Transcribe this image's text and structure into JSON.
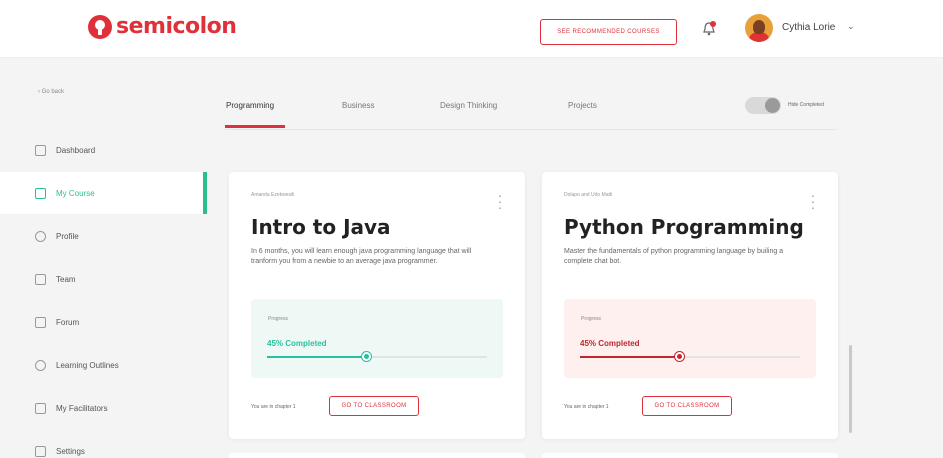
{
  "header": {
    "brand": "semicolon",
    "recommend_button": "SEE RECOMMENDED COURSES",
    "user_name": "Cythia Lorie",
    "user_chevron": "⌄"
  },
  "sidebar": {
    "go_back": "‹ Go back",
    "items": [
      {
        "label": "Dashboard",
        "icon": "dashboard-icon",
        "active": false
      },
      {
        "label": "My Course",
        "icon": "course-icon",
        "active": true
      },
      {
        "label": "Profile",
        "icon": "profile-icon",
        "active": false
      },
      {
        "label": "Team",
        "icon": "team-icon",
        "active": false
      },
      {
        "label": "Forum",
        "icon": "forum-icon",
        "active": false
      },
      {
        "label": "Learning Outlines",
        "icon": "outline-icon",
        "active": false
      },
      {
        "label": "My Facilitators",
        "icon": "facilitators-icon",
        "active": false
      },
      {
        "label": "Settings",
        "icon": "settings-icon",
        "active": false
      }
    ]
  },
  "tabs": [
    {
      "label": "Programming",
      "active": true
    },
    {
      "label": "Business",
      "active": false
    },
    {
      "label": "Design Thinking",
      "active": false
    },
    {
      "label": "Projects",
      "active": false
    }
  ],
  "toggle": {
    "label": "Hide Completed",
    "on": true
  },
  "courses": [
    {
      "subtitle": "Amanda Ezekwesili",
      "title": "Intro to Java",
      "description": "In 6 months, you will learn enough java programming language that will tranform you from a newbie to an average java programmer.",
      "progress_label": "Progress",
      "progress_text": "45% Completed",
      "progress": 0.45,
      "accent": "#2bbf9f",
      "box_bg": "#eef9f6",
      "footer": "You are in chapter 1",
      "button": "GO TO CLASSROOM"
    },
    {
      "subtitle": "Dolapo and Udo Matti",
      "title": "Python Programming",
      "description": "Master the fundamentals of python programming language by builing a complete chat bot.",
      "progress_label": "Progress",
      "progress_text": "45% Completed",
      "progress": 0.45,
      "accent": "#c0272e",
      "box_bg": "#fdf0ee",
      "footer": "You are in chapter 1",
      "button": "GO TO CLASSROOM"
    }
  ],
  "colors": {
    "brand": "#e0313b",
    "active_nav": "#2bbf8f"
  }
}
